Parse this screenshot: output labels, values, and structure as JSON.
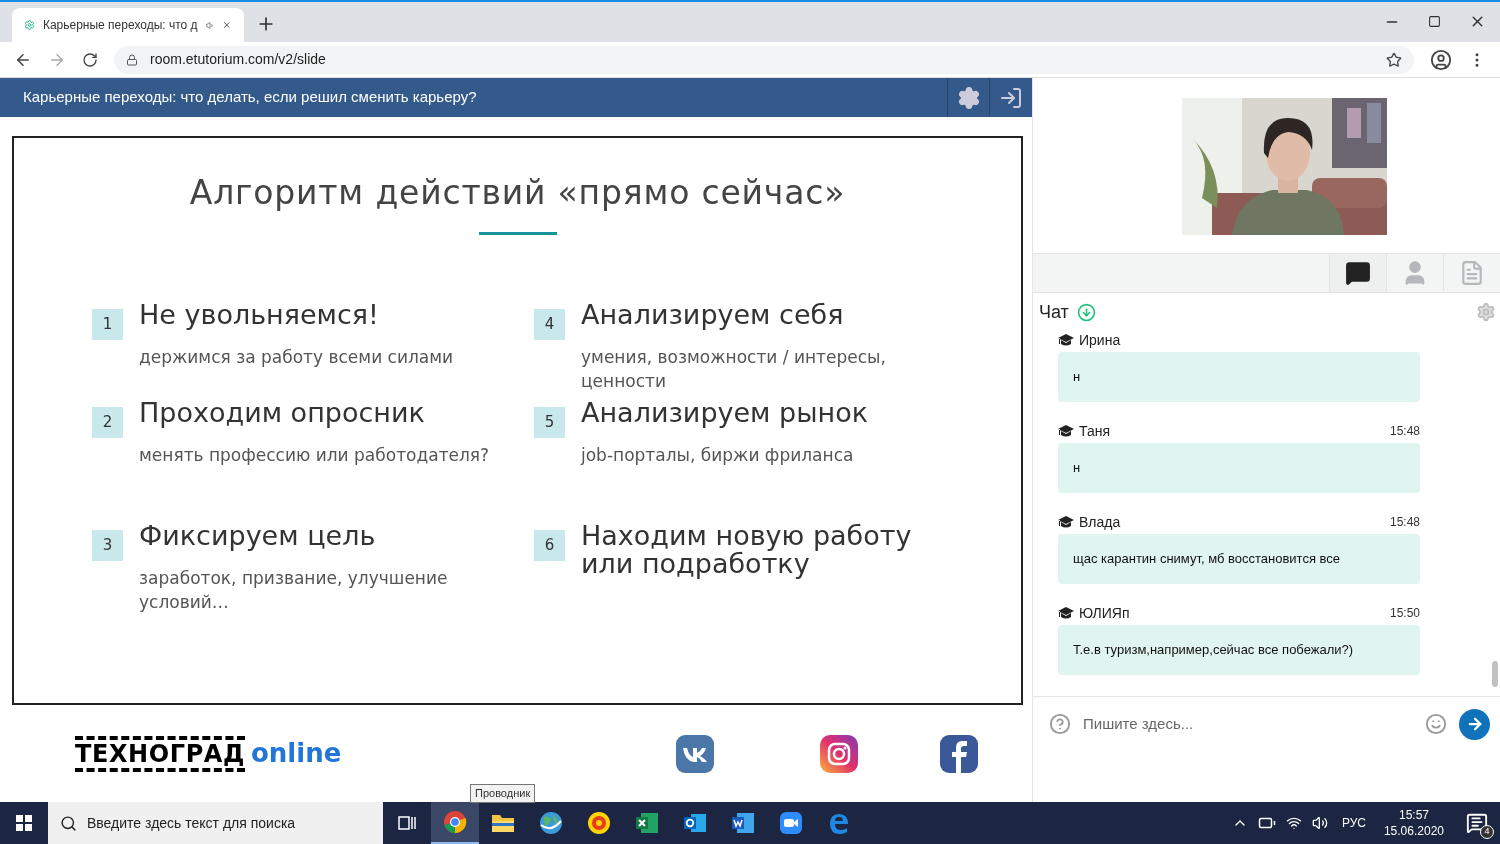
{
  "browser": {
    "tab": {
      "title": "Карьерные переходы: что д"
    },
    "url": "room.etutorium.com/v2/slide"
  },
  "header": {
    "title": "Карьерные переходы: что делать, если решил сменить карьеру?"
  },
  "slide": {
    "title": "Алгоритм действий «прямо сейчас»",
    "items": [
      {
        "number": "1",
        "title": "Не увольняемся!",
        "subtitle": "держимся за работу всеми силами"
      },
      {
        "number": "2",
        "title": "Проходим опросник",
        "subtitle": "менять профессию или работодателя?"
      },
      {
        "number": "3",
        "title": "Фиксируем цель",
        "subtitle": "заработок, призвание, улучшение условий…"
      },
      {
        "number": "4",
        "title": "Анализируем себя",
        "subtitle": "умения, возможности / интересы, ценности"
      },
      {
        "number": "5",
        "title": "Анализируем рынок",
        "subtitle": "job-порталы, биржи фриланса"
      },
      {
        "number": "6",
        "title": "Находим новую работу или подработку"
      }
    ]
  },
  "footer": {
    "logo": {
      "word": "ТЕХНОГРАД",
      "suffix": "online"
    }
  },
  "side_tabs": [
    {
      "kind": "chat",
      "selected": true
    },
    {
      "kind": "user",
      "selected": false
    },
    {
      "kind": "file",
      "selected": false
    }
  ],
  "chat": {
    "title": "Чат",
    "messages": [
      {
        "author": "Ирина",
        "text": "н"
      },
      {
        "author": "Таня",
        "time": "15:48",
        "text": "н"
      },
      {
        "author": "Влада",
        "time": "15:48",
        "text": "щас карантин снимут, мб восстановится все"
      },
      {
        "author": "ЮЛИЯп",
        "time": "15:50",
        "text": "Т.е.в туризм,например,сейчас все побежали?)"
      }
    ],
    "input": {
      "placeholder": "Пишите здесь..."
    }
  },
  "taskbar": {
    "search": {
      "placeholder": "Введите здесь текст для поиска"
    },
    "tooltip": "Проводник",
    "apps": [
      {
        "kind": "chrome",
        "selected": true
      },
      {
        "kind": "explorer",
        "selected": false
      },
      {
        "kind": "globe",
        "selected": false
      },
      {
        "kind": "onec",
        "selected": false
      },
      {
        "kind": "excel",
        "selected": false
      },
      {
        "kind": "outlook",
        "selected": false
      },
      {
        "kind": "word",
        "selected": false
      },
      {
        "kind": "zoom",
        "selected": false
      },
      {
        "kind": "edge",
        "selected": false
      }
    ],
    "language": "РУС",
    "time": "15:57",
    "date": "15.06.2020",
    "notifications": "4"
  }
}
